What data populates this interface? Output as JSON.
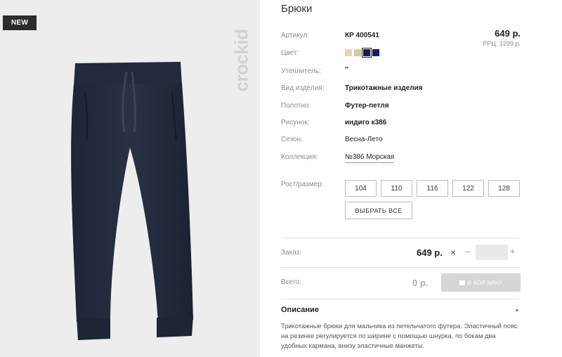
{
  "product": {
    "badge": "NEW",
    "brand_watermark": "crockid",
    "title": "Брюки",
    "price": "649 р.",
    "rrp": "РРЦ: 1299 р."
  },
  "attributes": {
    "article_label": "Артикул:",
    "article_value": "КР 400541",
    "color_label": "Цвет:",
    "colors": [
      "#e2d6b2",
      "#d6c7a6",
      "#141f4c",
      "#121d6a"
    ],
    "insulation_label": "Утеплитель:",
    "insulation_value": "\"",
    "type_label": "Вид изделия:",
    "type_value": "Трикотажные изделия",
    "fabric_label": "Полотно:",
    "fabric_value": "Футер-петля",
    "pattern_label": "Рисунок:",
    "pattern_value": "индиго к386",
    "season_label": "Сезон:",
    "season_value": "Весна-Лето",
    "collection_label": "Коллекция:",
    "collection_value": "№386 Морская",
    "size_label": "Рост/размер:",
    "sizes": [
      "104",
      "110",
      "116",
      "122",
      "128"
    ],
    "select_all": "ВЫБРАТЬ ВСЕ"
  },
  "order": {
    "order_label": "Заказ:",
    "order_price": "649 р.",
    "times": "×",
    "minus": "–",
    "plus": "+",
    "total_label": "Всего:",
    "total_value": "0 р.",
    "cart_button": "В КОРЗИНУ"
  },
  "description": {
    "title": "Описание",
    "caret": "▲",
    "text": "Трикотажные брюки для мальчика из петельчатого футера. Эластичный пояс на резинке регулируется по ширине с помощью шнурка, по бокам два удобных кармана, внизу эластичные манжеты."
  },
  "icons": {
    "cart": "shopping-bag-icon",
    "collapse": "caret-up-icon"
  }
}
